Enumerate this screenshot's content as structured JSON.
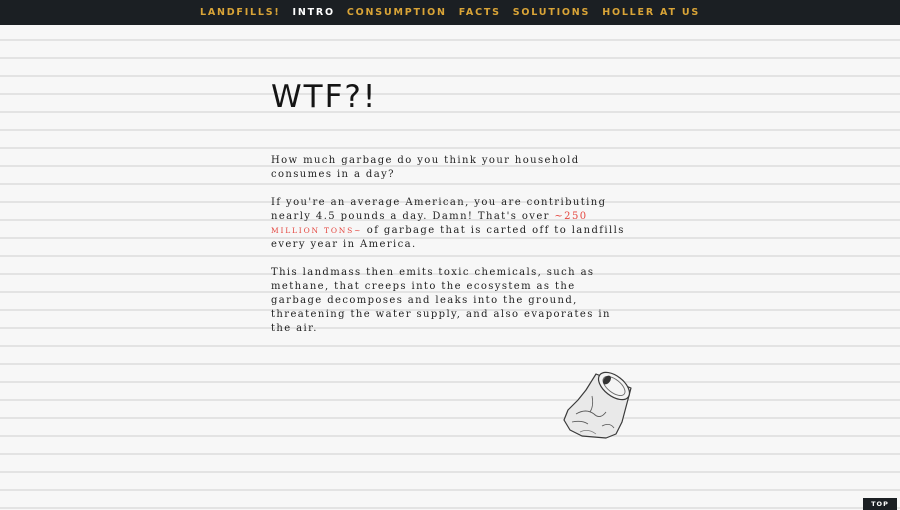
{
  "nav": {
    "items": [
      {
        "label": "LANDFILLS!"
      },
      {
        "label": "INTRO"
      },
      {
        "label": "CONSUMPTION"
      },
      {
        "label": "FACTS"
      },
      {
        "label": "SOLUTIONS"
      },
      {
        "label": "HOLLER AT US"
      }
    ],
    "active_index": 1
  },
  "main": {
    "title": "WTF?!",
    "para1": "How much garbage do you think your household consumes in a day?",
    "para2": {
      "before": "If you're an average American, you are contributing nearly 4.5 pounds a day. Damn! That's over ",
      "highlight_prefix": "~250 ",
      "highlight_small": "MILLION TONS~",
      "after": " of garbage that is carted off to landfills every year in America."
    },
    "para3": "This landmass then emits toxic chemicals, such as methane, that creeps into the ecosystem as the garbage decomposes and leaks into the ground, threatening the water supply, and also evaporates in the air."
  },
  "illustration": {
    "icon": "crushed-can-icon"
  },
  "top_button": {
    "label": "TOP"
  },
  "colors": {
    "nav_bg": "#1b1f23",
    "nav_link": "#d9a437",
    "nav_active": "#ffffff",
    "highlight": "#e4463f",
    "paper_line": "#e3e3e3"
  }
}
